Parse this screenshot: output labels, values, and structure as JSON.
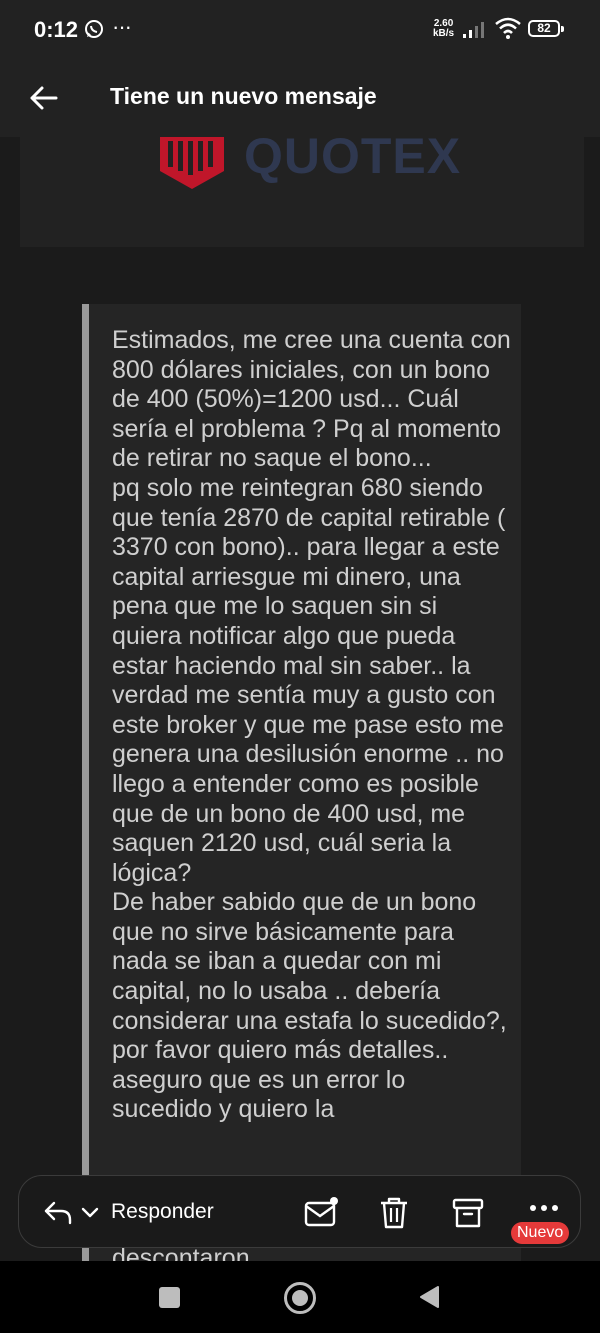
{
  "status_bar": {
    "time": "0:12",
    "more_symbol": "···",
    "speed_top": "2.60",
    "speed_bottom": "kB/s",
    "battery": "82"
  },
  "app_bar": {
    "title": "Tiene un nuevo mensaje"
  },
  "banner": {
    "logo_text": "QUOTEX",
    "logo_color": "#c0162a"
  },
  "message": {
    "body": "Estimados, me cree una cuenta con 800 dólares iniciales, con un bono de 400 (50%)=1200 usd... Cuál sería el problema ? Pq al momento de retirar no saque el bono...\npq solo me reintegran 680 siendo que tenía 2870 de capital retirable ( 3370 con bono).. para llegar a este capital arriesgue mi dinero, una pena que me lo saquen sin si quiera notificar algo que pueda estar haciendo mal sin saber.. la verdad me sentía muy a gusto con este broker y que me pase esto me genera una desilusión enorme .. no llego a entender como es posible que de un bono de 400 usd, me saquen 2120 usd, cuál seria la lógica?\nDe haber sabido que de un bono que no sirve básicamente para nada se iban a quedar con mi capital, no lo usaba .. debería considerar una estafa lo sucedido?, por favor quiero más detalles.. aseguro que es un error lo sucedido y quiero la",
    "partial_line": "descontaron"
  },
  "action_bar": {
    "reply_label": "Responder",
    "new_badge": "Nuevo",
    "badge_color": "#e53a3a"
  },
  "icons": {
    "reply": "reply-icon",
    "mark_unread": "mail-icon",
    "delete": "trash-icon",
    "archive": "archive-icon",
    "more": "more-icon"
  }
}
